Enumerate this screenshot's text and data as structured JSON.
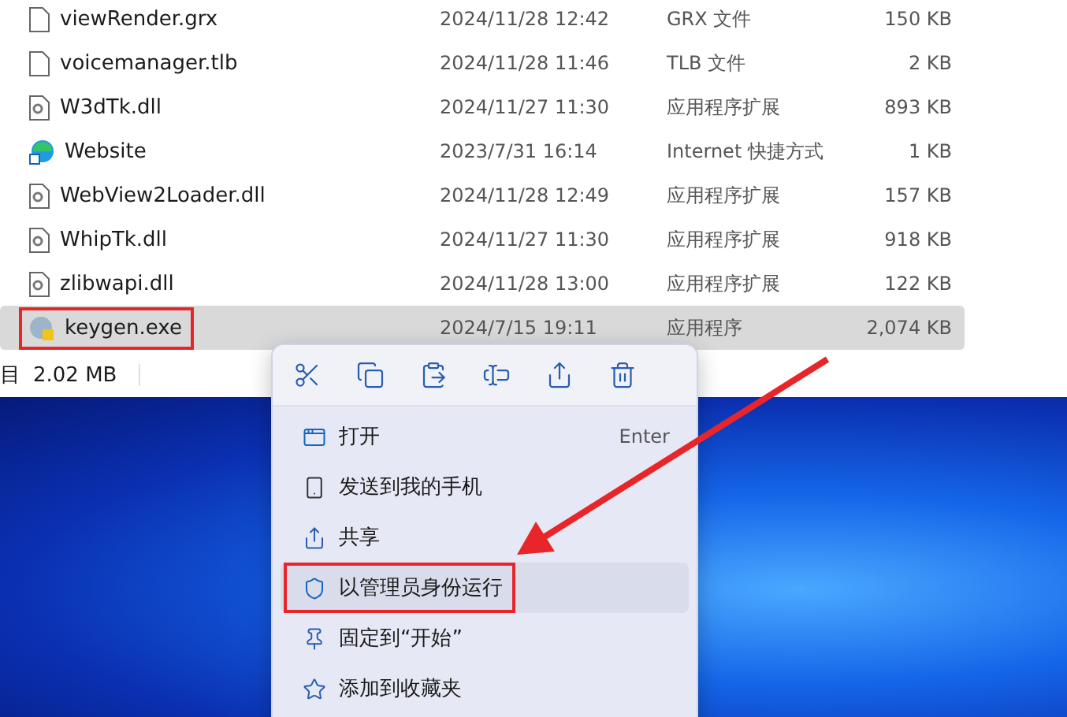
{
  "files": [
    {
      "name": "viewRender.grx",
      "date": "2024/11/28 12:42",
      "type": "GRX 文件",
      "size": "150 KB",
      "kind": "file",
      "selected": false,
      "highlighted": false
    },
    {
      "name": "voicemanager.tlb",
      "date": "2024/11/28 11:46",
      "type": "TLB 文件",
      "size": "2 KB",
      "kind": "file",
      "selected": false,
      "highlighted": false
    },
    {
      "name": "W3dTk.dll",
      "date": "2024/11/27 11:30",
      "type": "应用程序扩展",
      "size": "893 KB",
      "kind": "dll",
      "selected": false,
      "highlighted": false
    },
    {
      "name": "Website",
      "date": "2023/7/31 16:14",
      "type": "Internet 快捷方式",
      "size": "1 KB",
      "kind": "shortcut",
      "selected": false,
      "highlighted": false
    },
    {
      "name": "WebView2Loader.dll",
      "date": "2024/11/28 12:49",
      "type": "应用程序扩展",
      "size": "157 KB",
      "kind": "dll",
      "selected": false,
      "highlighted": false
    },
    {
      "name": "WhipTk.dll",
      "date": "2024/11/27 11:30",
      "type": "应用程序扩展",
      "size": "918 KB",
      "kind": "dll",
      "selected": false,
      "highlighted": false
    },
    {
      "name": "zlibwapi.dll",
      "date": "2024/11/28 13:00",
      "type": "应用程序扩展",
      "size": "122 KB",
      "kind": "dll",
      "selected": false,
      "highlighted": false
    },
    {
      "name": "keygen.exe",
      "date": "2024/7/15 19:11",
      "type": "应用程序",
      "size": "2,074 KB",
      "kind": "exe",
      "selected": true,
      "highlighted": true
    }
  ],
  "status_bar": {
    "items_label": "目",
    "selection_size": "2.02 MB"
  },
  "context_menu": {
    "items": [
      {
        "label": "打开",
        "shortcut": "Enter",
        "kind": "open",
        "hovered": false,
        "highlighted": false
      },
      {
        "label": "发送到我的手机",
        "kind": "phone",
        "hovered": false,
        "highlighted": false
      },
      {
        "label": "共享",
        "kind": "share",
        "hovered": false,
        "highlighted": false
      },
      {
        "label": "以管理员身份运行",
        "kind": "admin",
        "hovered": true,
        "highlighted": true
      },
      {
        "label": "固定到“开始”",
        "kind": "pin",
        "hovered": false,
        "highlighted": false
      },
      {
        "label": "添加到收藏夹",
        "kind": "star",
        "hovered": false,
        "highlighted": false
      }
    ]
  }
}
